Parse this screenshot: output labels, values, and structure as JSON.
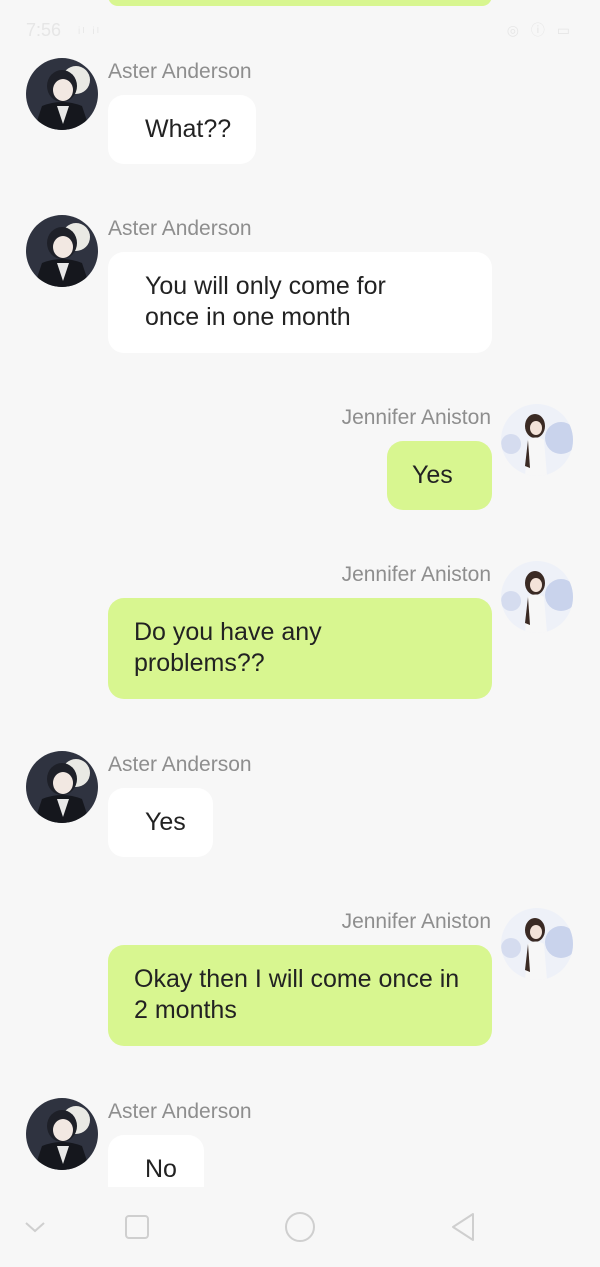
{
  "status_bar": {
    "time": "7:56",
    "signal": "ᵢₗ ᵢₗ",
    "indicators": "◎ ⓘ ▭"
  },
  "messages": [
    {
      "side": "left",
      "sender": "Aster Anderson",
      "text": "What??",
      "avatar": "aster-avatar"
    },
    {
      "side": "left",
      "sender": "Aster Anderson",
      "text": "You will only come for once in one month",
      "avatar": "aster-avatar"
    },
    {
      "side": "right",
      "sender": "Jennifer Aniston",
      "text": "Yes",
      "avatar": "jennifer-avatar"
    },
    {
      "side": "right",
      "sender": "Jennifer Aniston",
      "text": "Do you have any problems??",
      "avatar": "jennifer-avatar"
    },
    {
      "side": "left",
      "sender": "Aster Anderson",
      "text": "Yes",
      "avatar": "aster-avatar"
    },
    {
      "side": "right",
      "sender": "Jennifer Aniston",
      "text": "Okay then I will come once in 2 months",
      "avatar": "jennifer-avatar"
    },
    {
      "side": "left",
      "sender": "Aster Anderson",
      "text": "No",
      "avatar": "aster-avatar"
    }
  ],
  "nav_bar": {
    "buttons": [
      "chevron-down-icon",
      "square-recents-icon",
      "circle-home-icon",
      "triangle-back-icon"
    ]
  },
  "colors": {
    "outgoing_bubble": "#d8f690",
    "incoming_bubble": "#ffffff",
    "background": "#f7f7f7",
    "sender_name": "#8e8e8e"
  }
}
